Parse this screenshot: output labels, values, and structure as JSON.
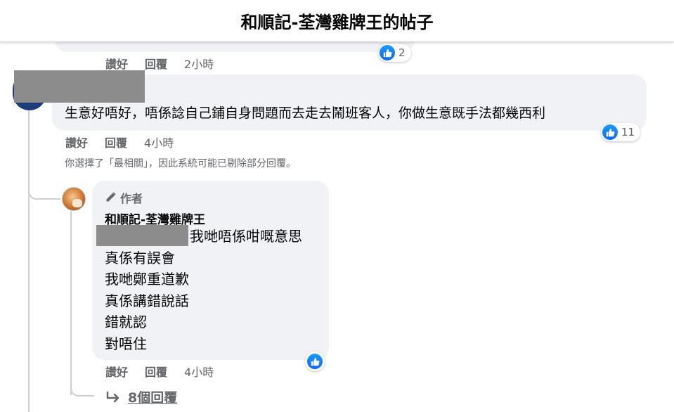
{
  "header": {
    "title": "和順記-荃灣雞牌王的帖子"
  },
  "previous_comment": {
    "like_label": "讚好",
    "reply_label": "回覆",
    "time": "2小時",
    "reaction_count": "2"
  },
  "comment": {
    "text": "生意好唔好，唔係諗自己鋪自身問題而去走去鬧班客人，你做生意既手法都幾西利",
    "like_label": "讚好",
    "reply_label": "回覆",
    "time": "4小時",
    "reaction_count": "11"
  },
  "filter_note": "你選擇了「最相關」，因此系統可能已剔除部分回覆。",
  "reply": {
    "author_tag": "作者",
    "author_name": "和順記-荃灣雞牌王",
    "lines": [
      "我哋唔係咁嘅意思",
      "真係有誤會",
      "我哋鄭重道歉",
      "真係講錯說話",
      "錯就認",
      "對唔住"
    ],
    "like_label": "讚好",
    "reply_label": "回覆",
    "time": "4小時"
  },
  "more_replies": {
    "label": "8個回覆"
  },
  "colors": {
    "like_blue": "#0866ff",
    "bubble_bg": "#f0f2f5",
    "meta_gray": "#65676b"
  }
}
